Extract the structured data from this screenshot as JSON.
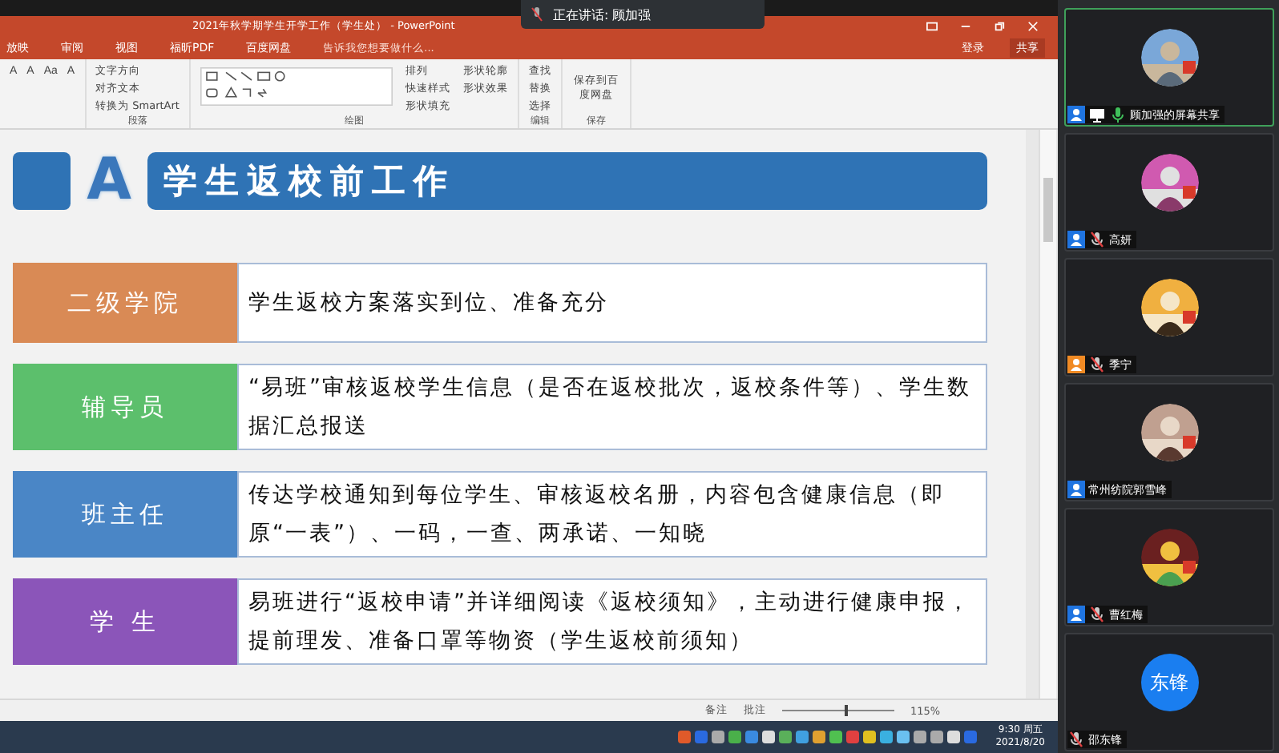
{
  "speaking_banner": {
    "text": "正在讲话: 顾加强"
  },
  "powerpoint": {
    "title": "2021年秋学期学生开学工作（学生处） - PowerPoint",
    "sign_in": "登录",
    "share": "共享",
    "tabs": [
      {
        "label": "放映",
        "selected": false
      },
      {
        "label": "审阅",
        "selected": false
      },
      {
        "label": "视图",
        "selected": false
      },
      {
        "label": "福昕PDF",
        "selected": false
      },
      {
        "label": "百度网盘",
        "selected": false
      }
    ],
    "tell_me": {
      "placeholder": "告诉我您想要做什么..."
    },
    "font_controls": [
      "A",
      "A",
      "Aa",
      "A"
    ],
    "ribbon_groups": [
      {
        "label": "段落",
        "items": [
          "文字方向",
          "对齐文本",
          "转换为 SmartArt"
        ]
      },
      {
        "label": "绘图",
        "items": [
          "排列",
          "快速样式",
          "形状填充",
          "形状轮廓",
          "形状效果"
        ]
      },
      {
        "label": "编辑",
        "items": [
          "查找",
          "替换",
          "选择"
        ]
      },
      {
        "label": "保存",
        "items": [
          "保存到百度网盘"
        ]
      }
    ],
    "slide": {
      "badge": "A",
      "title": "学生返校前工作",
      "rows": [
        {
          "label": "二级学院",
          "color": "#d98a55",
          "text": "学生返校方案落实到位、准备充分"
        },
        {
          "label": "辅导员",
          "color": "#5cbf6c",
          "text": "“易班”审核返校学生信息（是否在返校批次，返校条件等）、学生数据汇总报送"
        },
        {
          "label": "班主任",
          "color": "#4a86c6",
          "text": "传达学校通知到每位学生、审核返校名册，内容包含健康信息（即原“一表”）、一码，一查、两承诺、一知晓"
        },
        {
          "label": "学 生",
          "color": "#8b55b9",
          "text": "易班进行“返校申请”并详细阅读《返校须知》，主动进行健康申报，提前理发、准备口罩等物资（学生返校前须知）"
        }
      ]
    },
    "status_bar": {
      "notes": "备注",
      "comments": "批注",
      "zoom": "115%",
      "level": 0.55
    }
  },
  "taskbar": {
    "time": "9:30 周五",
    "date": "2021/8/20"
  },
  "participants": [
    {
      "name": "顾加强的屏幕共享",
      "color": "#1f74e0",
      "sharing": true,
      "mic": {
        "muted": false
      },
      "speaking": true
    },
    {
      "name": "高妍",
      "color": "#1f74e0",
      "sharing": false,
      "mic": {
        "muted": true
      },
      "speaking": false
    },
    {
      "name": "季宁",
      "color": "#f08a24",
      "sharing": false,
      "mic": {
        "muted": true
      },
      "speaking": false
    },
    {
      "name": "常州纺院郭雪峰",
      "color": "#1f74e0",
      "sharing": false,
      "speaking": false
    },
    {
      "name": "曹红梅",
      "color": "#1f74e0",
      "sharing": false,
      "mic": {
        "muted": true
      },
      "speaking": false
    },
    {
      "name": "邵东锋",
      "sharing": false,
      "mic": {
        "muted": true
      },
      "speaking": false,
      "avatar": {
        "kind": "initials",
        "text": "东锋"
      }
    }
  ]
}
